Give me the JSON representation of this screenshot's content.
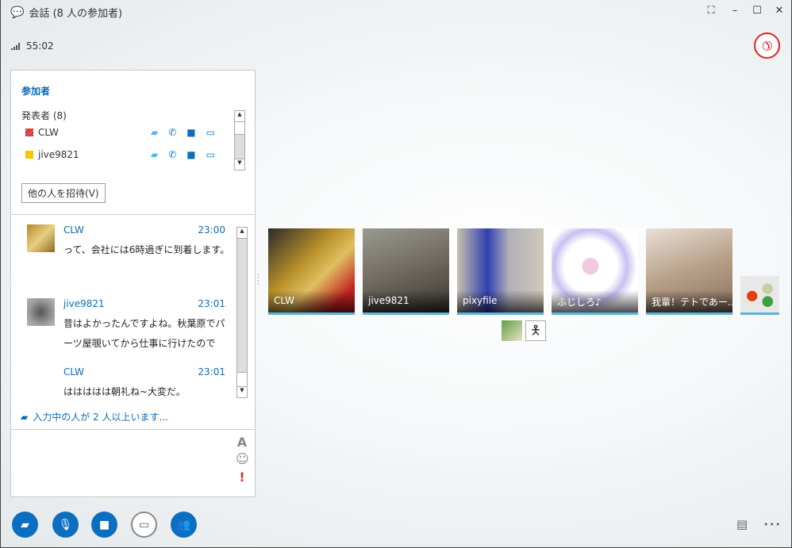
{
  "window": {
    "title": "会話 (8 人の参加者)",
    "restore": "⛶",
    "minimize": "–",
    "maximize": "☐",
    "close": "✕"
  },
  "call": {
    "duration": "55:02",
    "signal_icon": "signal-icon",
    "hangup_icon": "☎"
  },
  "participants": {
    "heading": "参加者",
    "group_label": "発表者 (8)",
    "items": [
      {
        "name": "CLW",
        "color": "#d03030"
      },
      {
        "name": "jive9821",
        "color": "#f5c800"
      }
    ],
    "invite_label": "他の人を招待(V)"
  },
  "chat": {
    "messages": [
      {
        "name": "CLW",
        "time": "23:00",
        "text": "って、会社には6時過ぎに到着します。"
      },
      {
        "name": "jive9821",
        "time": "23:01",
        "text": "昔はよかったんですよね。秋葉原でパーツ屋覗いてから仕事に行けたので"
      },
      {
        "name": "CLW",
        "time": "23:01",
        "text": "ははははは朝礼ね~大変だ。"
      }
    ],
    "typing": "入力中の人が 2 人以上います...",
    "font_icon": "A",
    "emoji_icon": "☺",
    "important_icon": "!"
  },
  "videos": [
    {
      "name": "CLW"
    },
    {
      "name": "jive9821"
    },
    {
      "name": "pixyfile"
    },
    {
      "name": "ふじしろ♪"
    },
    {
      "name": "我輩！テトであー…"
    }
  ],
  "more": "•••"
}
